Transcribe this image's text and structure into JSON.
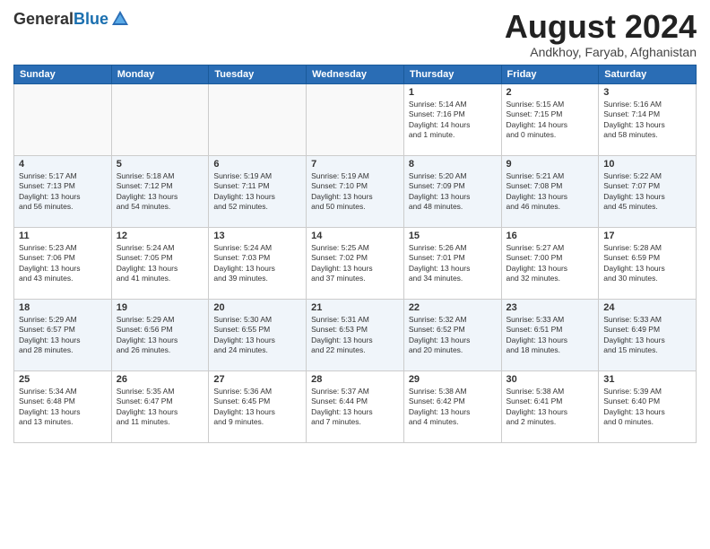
{
  "header": {
    "logo_general": "General",
    "logo_blue": "Blue",
    "month_year": "August 2024",
    "location": "Andkhoy, Faryab, Afghanistan"
  },
  "days_of_week": [
    "Sunday",
    "Monday",
    "Tuesday",
    "Wednesday",
    "Thursday",
    "Friday",
    "Saturday"
  ],
  "weeks": [
    [
      {
        "day": "",
        "info": ""
      },
      {
        "day": "",
        "info": ""
      },
      {
        "day": "",
        "info": ""
      },
      {
        "day": "",
        "info": ""
      },
      {
        "day": "1",
        "info": "Sunrise: 5:14 AM\nSunset: 7:16 PM\nDaylight: 14 hours\nand 1 minute."
      },
      {
        "day": "2",
        "info": "Sunrise: 5:15 AM\nSunset: 7:15 PM\nDaylight: 14 hours\nand 0 minutes."
      },
      {
        "day": "3",
        "info": "Sunrise: 5:16 AM\nSunset: 7:14 PM\nDaylight: 13 hours\nand 58 minutes."
      }
    ],
    [
      {
        "day": "4",
        "info": "Sunrise: 5:17 AM\nSunset: 7:13 PM\nDaylight: 13 hours\nand 56 minutes."
      },
      {
        "day": "5",
        "info": "Sunrise: 5:18 AM\nSunset: 7:12 PM\nDaylight: 13 hours\nand 54 minutes."
      },
      {
        "day": "6",
        "info": "Sunrise: 5:19 AM\nSunset: 7:11 PM\nDaylight: 13 hours\nand 52 minutes."
      },
      {
        "day": "7",
        "info": "Sunrise: 5:19 AM\nSunset: 7:10 PM\nDaylight: 13 hours\nand 50 minutes."
      },
      {
        "day": "8",
        "info": "Sunrise: 5:20 AM\nSunset: 7:09 PM\nDaylight: 13 hours\nand 48 minutes."
      },
      {
        "day": "9",
        "info": "Sunrise: 5:21 AM\nSunset: 7:08 PM\nDaylight: 13 hours\nand 46 minutes."
      },
      {
        "day": "10",
        "info": "Sunrise: 5:22 AM\nSunset: 7:07 PM\nDaylight: 13 hours\nand 45 minutes."
      }
    ],
    [
      {
        "day": "11",
        "info": "Sunrise: 5:23 AM\nSunset: 7:06 PM\nDaylight: 13 hours\nand 43 minutes."
      },
      {
        "day": "12",
        "info": "Sunrise: 5:24 AM\nSunset: 7:05 PM\nDaylight: 13 hours\nand 41 minutes."
      },
      {
        "day": "13",
        "info": "Sunrise: 5:24 AM\nSunset: 7:03 PM\nDaylight: 13 hours\nand 39 minutes."
      },
      {
        "day": "14",
        "info": "Sunrise: 5:25 AM\nSunset: 7:02 PM\nDaylight: 13 hours\nand 37 minutes."
      },
      {
        "day": "15",
        "info": "Sunrise: 5:26 AM\nSunset: 7:01 PM\nDaylight: 13 hours\nand 34 minutes."
      },
      {
        "day": "16",
        "info": "Sunrise: 5:27 AM\nSunset: 7:00 PM\nDaylight: 13 hours\nand 32 minutes."
      },
      {
        "day": "17",
        "info": "Sunrise: 5:28 AM\nSunset: 6:59 PM\nDaylight: 13 hours\nand 30 minutes."
      }
    ],
    [
      {
        "day": "18",
        "info": "Sunrise: 5:29 AM\nSunset: 6:57 PM\nDaylight: 13 hours\nand 28 minutes."
      },
      {
        "day": "19",
        "info": "Sunrise: 5:29 AM\nSunset: 6:56 PM\nDaylight: 13 hours\nand 26 minutes."
      },
      {
        "day": "20",
        "info": "Sunrise: 5:30 AM\nSunset: 6:55 PM\nDaylight: 13 hours\nand 24 minutes."
      },
      {
        "day": "21",
        "info": "Sunrise: 5:31 AM\nSunset: 6:53 PM\nDaylight: 13 hours\nand 22 minutes."
      },
      {
        "day": "22",
        "info": "Sunrise: 5:32 AM\nSunset: 6:52 PM\nDaylight: 13 hours\nand 20 minutes."
      },
      {
        "day": "23",
        "info": "Sunrise: 5:33 AM\nSunset: 6:51 PM\nDaylight: 13 hours\nand 18 minutes."
      },
      {
        "day": "24",
        "info": "Sunrise: 5:33 AM\nSunset: 6:49 PM\nDaylight: 13 hours\nand 15 minutes."
      }
    ],
    [
      {
        "day": "25",
        "info": "Sunrise: 5:34 AM\nSunset: 6:48 PM\nDaylight: 13 hours\nand 13 minutes."
      },
      {
        "day": "26",
        "info": "Sunrise: 5:35 AM\nSunset: 6:47 PM\nDaylight: 13 hours\nand 11 minutes."
      },
      {
        "day": "27",
        "info": "Sunrise: 5:36 AM\nSunset: 6:45 PM\nDaylight: 13 hours\nand 9 minutes."
      },
      {
        "day": "28",
        "info": "Sunrise: 5:37 AM\nSunset: 6:44 PM\nDaylight: 13 hours\nand 7 minutes."
      },
      {
        "day": "29",
        "info": "Sunrise: 5:38 AM\nSunset: 6:42 PM\nDaylight: 13 hours\nand 4 minutes."
      },
      {
        "day": "30",
        "info": "Sunrise: 5:38 AM\nSunset: 6:41 PM\nDaylight: 13 hours\nand 2 minutes."
      },
      {
        "day": "31",
        "info": "Sunrise: 5:39 AM\nSunset: 6:40 PM\nDaylight: 13 hours\nand 0 minutes."
      }
    ]
  ]
}
